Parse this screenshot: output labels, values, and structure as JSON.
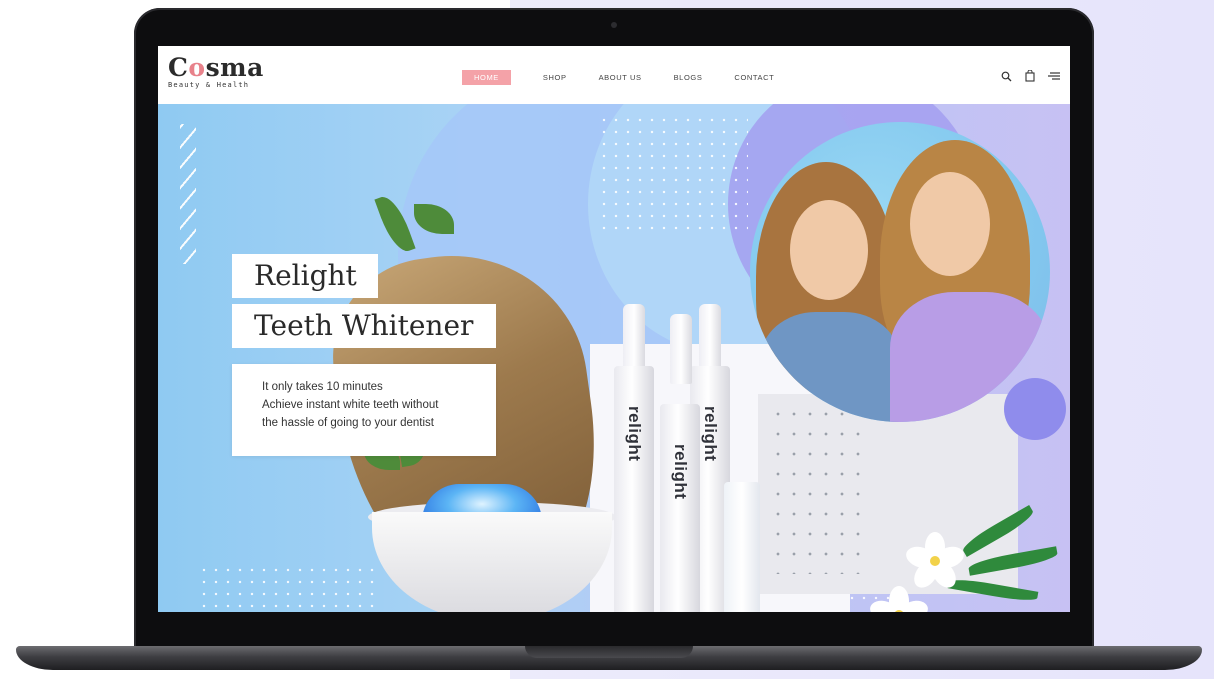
{
  "brand": {
    "logo_text_part1": "C",
    "logo_text_o": "o",
    "logo_text_part2": "sma",
    "tagline": "Beauty & Health"
  },
  "nav": {
    "items": [
      {
        "label": "HOME",
        "active": true
      },
      {
        "label": "SHOP",
        "active": false
      },
      {
        "label": "ABOUT US",
        "active": false
      },
      {
        "label": "BLOGS",
        "active": false
      },
      {
        "label": "CONTACT",
        "active": false
      }
    ]
  },
  "header_icons": [
    "search-icon",
    "cart-icon",
    "menu-icon"
  ],
  "hero": {
    "title_line1": "Relight",
    "title_line2": "Teeth Whitener",
    "desc_line1": "It only takes 10 minutes",
    "desc_line2": "Achieve instant white teeth without",
    "desc_line3": "the hassle of going to your dentist",
    "product_brand": "relight"
  },
  "colors": {
    "accent_pink": "#f4a2a8",
    "logo_o": "#e8828b",
    "hero_blue": "#a9d3f5",
    "hero_purple": "#c7c1f3"
  }
}
